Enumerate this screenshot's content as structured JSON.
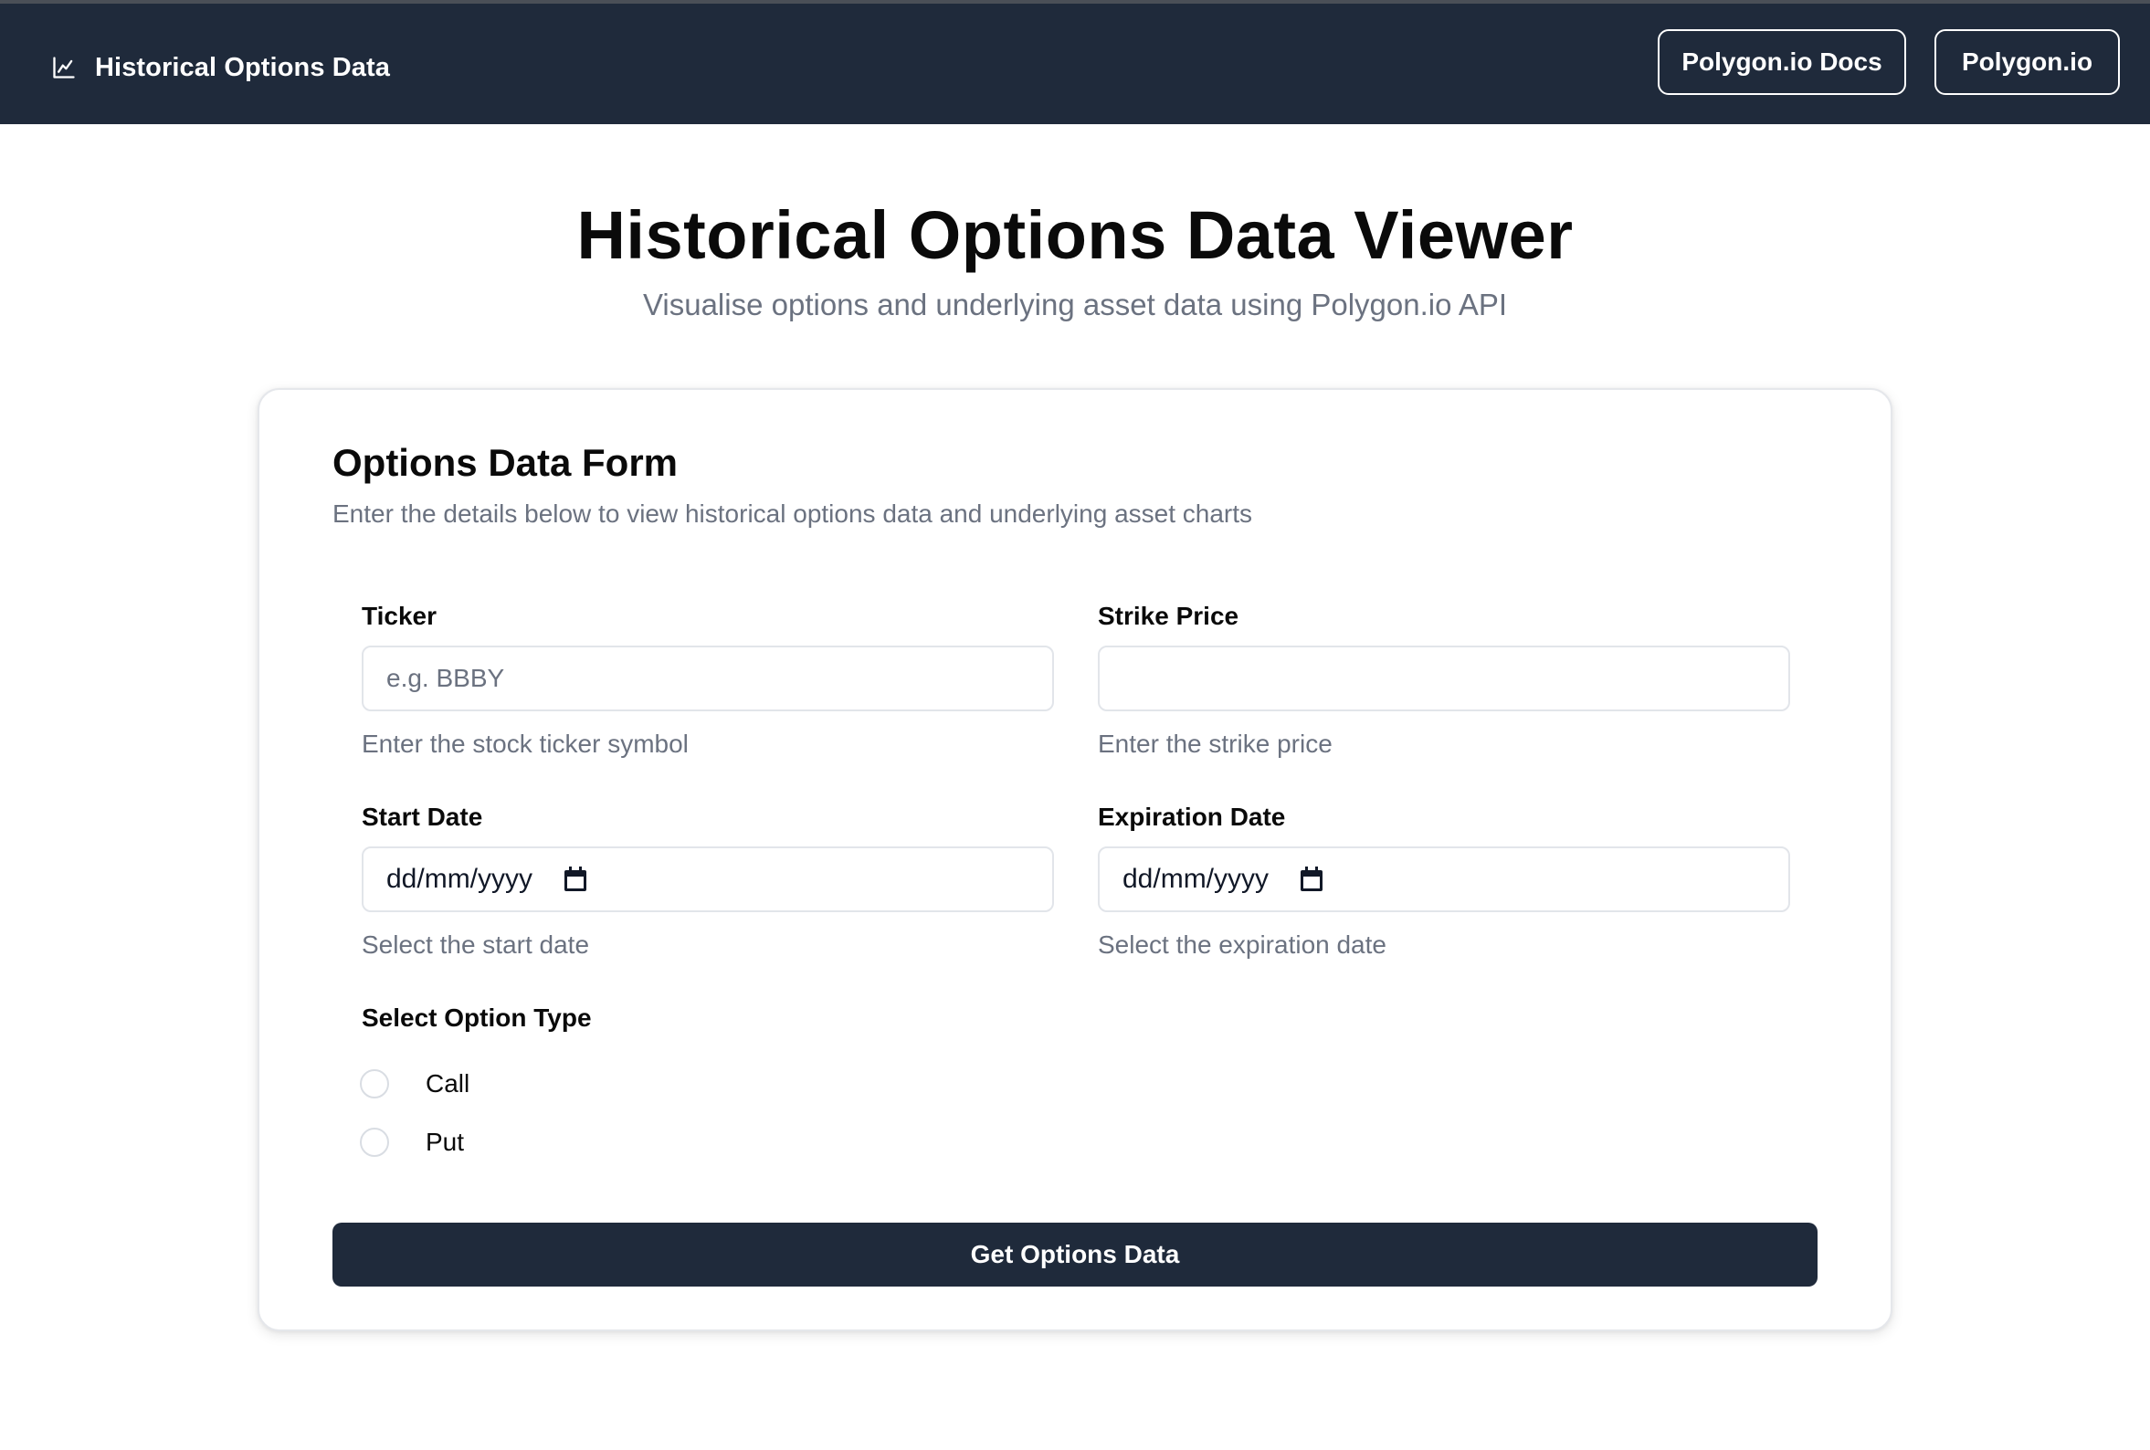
{
  "navbar": {
    "brand_icon": "chart-icon",
    "brand_text": "Historical Options Data",
    "links": [
      {
        "label": "Polygon.io Docs"
      },
      {
        "label": "Polygon.io"
      }
    ]
  },
  "hero": {
    "title": "Historical Options Data Viewer",
    "subtitle": "Visualise options and underlying asset data using Polygon.io API"
  },
  "form": {
    "title": "Options Data Form",
    "description": "Enter the details below to view historical options data and underlying asset charts",
    "ticker": {
      "label": "Ticker",
      "placeholder": "e.g. BBBY",
      "value": "",
      "help": "Enter the stock ticker symbol"
    },
    "strike": {
      "label": "Strike Price",
      "placeholder": "",
      "value": "",
      "help": "Enter the strike price"
    },
    "start_date": {
      "label": "Start Date",
      "value": "dd/mm/yyyy",
      "icon": "calendar-icon",
      "help": "Select the start date"
    },
    "expiration_date": {
      "label": "Expiration Date",
      "value": "dd/mm/yyyy",
      "icon": "calendar-icon",
      "help": "Select the expiration date"
    },
    "option_type": {
      "label": "Select Option Type",
      "options": [
        {
          "label": "Call",
          "selected": false
        },
        {
          "label": "Put",
          "selected": false
        }
      ]
    },
    "submit_label": "Get Options Data"
  },
  "colors": {
    "navbar_bg": "#1f2a3b",
    "button_bg": "#1f2a3b",
    "muted_text": "#6b7280",
    "border": "#e2e5ea"
  }
}
